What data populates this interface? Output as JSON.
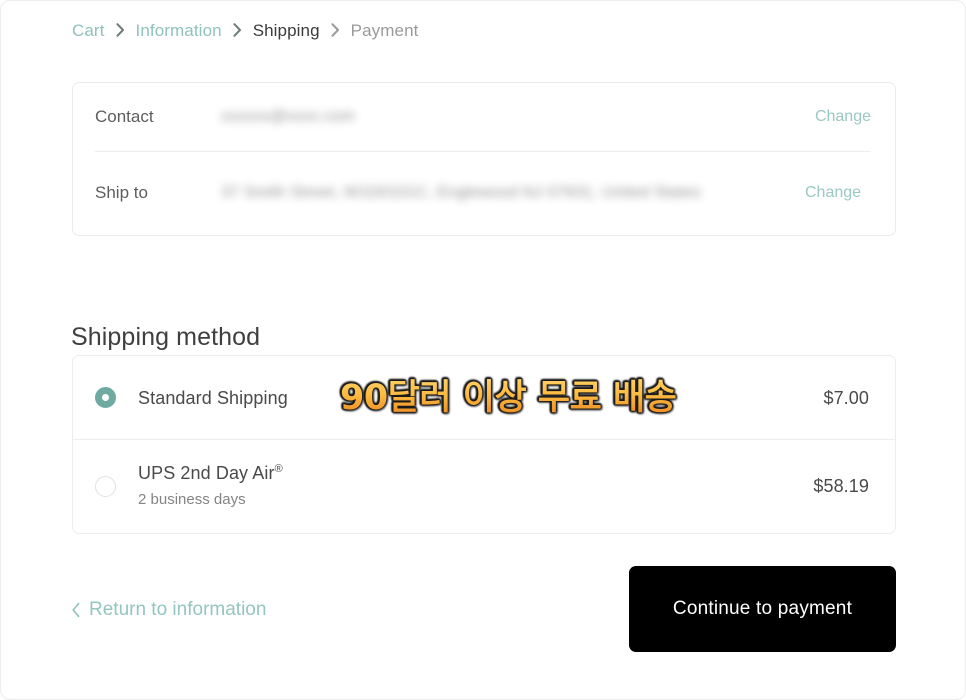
{
  "breadcrumb": {
    "separator_icon": "chevron-right-icon",
    "items": [
      {
        "label": "Cart",
        "state": "link"
      },
      {
        "label": "Information",
        "state": "link"
      },
      {
        "label": "Shipping",
        "state": "active"
      },
      {
        "label": "Payment",
        "state": "pending"
      }
    ]
  },
  "summary": {
    "contact": {
      "label": "Contact",
      "value": "xxxxxx@xxxx.com",
      "value_redacted": true,
      "change_label": "Change"
    },
    "ship_to": {
      "label": "Ship to",
      "value": "37 Smith Street, W1D0101C, Englewood NJ 07631, United States",
      "value_redacted": true,
      "change_label": "Change"
    }
  },
  "shipping_method": {
    "title": "Shipping method",
    "options": [
      {
        "name": "Standard Shipping",
        "subtitle": "",
        "price": "$7.00",
        "selected": true,
        "registered_mark": false
      },
      {
        "name": "UPS 2nd Day Air",
        "subtitle": "2 business days",
        "price": "$58.19",
        "selected": false,
        "registered_mark": true
      }
    ]
  },
  "promo_overlay": {
    "text": "90달러 이상 무료 배송",
    "fill_top_color": "#ffd46a",
    "fill_bottom_color": "#e5832a",
    "outline_color": "#141414"
  },
  "footer": {
    "return_label": "Return to information",
    "return_icon": "chevron-left-icon",
    "continue_label": "Continue to payment"
  },
  "colors": {
    "accent_teal": "#6faaa1",
    "link_teal": "#94c5c0",
    "button_black": "#000000",
    "text_dark": "#3f3f3f",
    "text_muted": "#848484",
    "border": "#ececec"
  }
}
